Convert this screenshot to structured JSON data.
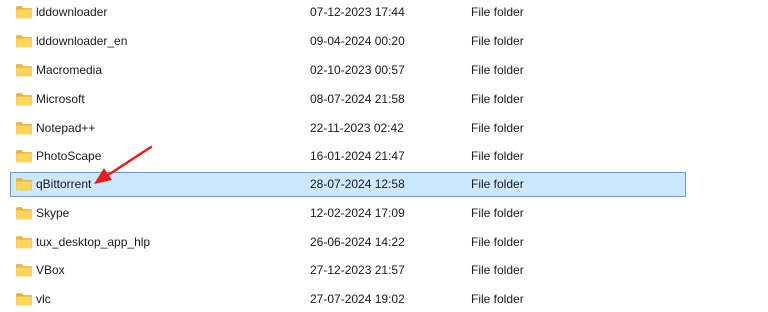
{
  "icons": {
    "folder": "folder-icon",
    "annotation": "red-arrow-annotation"
  },
  "colors": {
    "selection_background": "#cce8ff",
    "selection_border": "#5f9ed9",
    "folder_yellow": "#f7c948",
    "arrow_red": "#e8201c"
  },
  "files": [
    {
      "name": "lddownloader",
      "date": "07-12-2023 17:44",
      "type": "File folder",
      "selected": false
    },
    {
      "name": "lddownloader_en",
      "date": "09-04-2024 00:20",
      "type": "File folder",
      "selected": false
    },
    {
      "name": "Macromedia",
      "date": "02-10-2023 00:57",
      "type": "File folder",
      "selected": false
    },
    {
      "name": "Microsoft",
      "date": "08-07-2024 21:58",
      "type": "File folder",
      "selected": false
    },
    {
      "name": "Notepad++",
      "date": "22-11-2023 02:42",
      "type": "File folder",
      "selected": false
    },
    {
      "name": "PhotoScape",
      "date": "16-01-2024 21:47",
      "type": "File folder",
      "selected": false
    },
    {
      "name": "qBittorrent",
      "date": "28-07-2024 12:58",
      "type": "File folder",
      "selected": true
    },
    {
      "name": "Skype",
      "date": "12-02-2024 17:09",
      "type": "File folder",
      "selected": false
    },
    {
      "name": "tux_desktop_app_hlp",
      "date": "26-06-2024 14:22",
      "type": "File folder",
      "selected": false
    },
    {
      "name": "VBox",
      "date": "27-12-2023 21:57",
      "type": "File folder",
      "selected": false
    },
    {
      "name": "vlc",
      "date": "27-07-2024 19:02",
      "type": "File folder",
      "selected": false
    }
  ]
}
